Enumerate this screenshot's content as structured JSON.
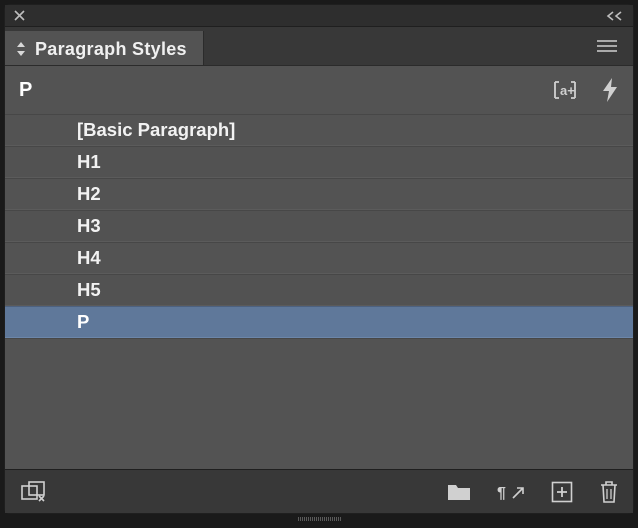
{
  "panel": {
    "tab_title": "Paragraph Styles",
    "active_style": "P"
  },
  "styles": [
    {
      "name": "[Basic Paragraph]",
      "selected": false
    },
    {
      "name": "H1",
      "selected": false
    },
    {
      "name": "H2",
      "selected": false
    },
    {
      "name": "H3",
      "selected": false
    },
    {
      "name": "H4",
      "selected": false
    },
    {
      "name": "H5",
      "selected": false
    },
    {
      "name": "P",
      "selected": true
    }
  ],
  "icons": {
    "close": "close-icon",
    "collapse": "collapse-icon",
    "sort": "sort-icon",
    "menu": "menu-icon",
    "new_from_sel": "new-style-from-selection-icon",
    "bolt": "quick-apply-icon",
    "cc_libraries": "cc-libraries-icon",
    "folder": "style-group-icon",
    "clear_overrides": "clear-overrides-icon",
    "new": "new-style-icon",
    "delete": "delete-icon"
  }
}
